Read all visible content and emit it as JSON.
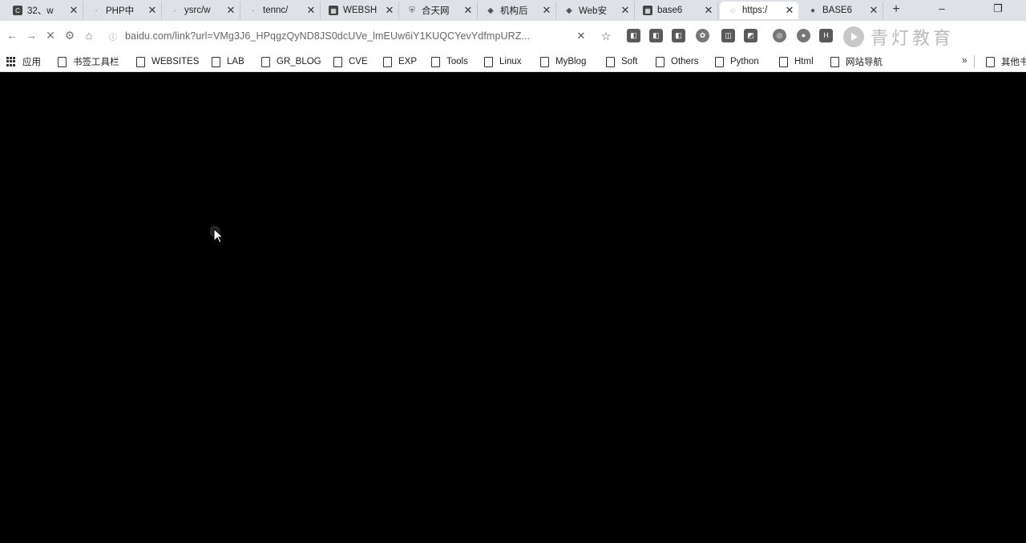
{
  "tabs": [
    {
      "title": "32、w",
      "favicon": "page-icon",
      "active": false
    },
    {
      "title": "PHP中",
      "favicon": "page-icon",
      "active": false
    },
    {
      "title": "ysrc/w",
      "favicon": "github-icon",
      "active": false
    },
    {
      "title": "tennc/",
      "favicon": "github-icon",
      "active": false
    },
    {
      "title": "WEBSH",
      "favicon": "page-icon",
      "active": false
    },
    {
      "title": "合天网",
      "favicon": "shield-icon",
      "active": false
    },
    {
      "title": "机构后",
      "favicon": "diamond-icon",
      "active": false
    },
    {
      "title": "Web安",
      "favicon": "diamond-icon",
      "active": false
    },
    {
      "title": "base6",
      "favicon": "page-icon",
      "active": false
    },
    {
      "title": "https:/",
      "favicon": "loading-icon",
      "active": true
    },
    {
      "title": "BASE6",
      "favicon": "dot-icon",
      "active": false
    }
  ],
  "address_bar": {
    "url": "baidu.com/link?url=VMg3J6_HPqgzQyND8JS0dcUVe_lmEUw6iY1KUQCYevYdfmpURZ..."
  },
  "watermark": {
    "text": "青灯教育"
  },
  "bookmarks": [
    {
      "label": "应用",
      "icon": "apps-grid-icon"
    },
    {
      "label": "书签工具栏",
      "icon": "folder-icon"
    },
    {
      "label": "WEBSITES",
      "icon": "folder-icon"
    },
    {
      "label": "LAB",
      "icon": "folder-icon"
    },
    {
      "label": "GR_BLOG",
      "icon": "folder-icon"
    },
    {
      "label": "CVE",
      "icon": "folder-icon"
    },
    {
      "label": "EXP",
      "icon": "folder-icon"
    },
    {
      "label": "Tools",
      "icon": "folder-icon"
    },
    {
      "label": "Linux",
      "icon": "folder-icon"
    },
    {
      "label": "MyBlog",
      "icon": "folder-icon"
    },
    {
      "label": "Soft",
      "icon": "folder-icon"
    },
    {
      "label": "Others",
      "icon": "folder-icon"
    },
    {
      "label": "Python",
      "icon": "folder-icon"
    },
    {
      "label": "Html",
      "icon": "folder-icon"
    },
    {
      "label": "网站导航",
      "icon": "folder-icon"
    }
  ],
  "bookmarks_more": "»",
  "other_bookmarks": "其他书签",
  "colors": {
    "tab_strip": "#dee1e6",
    "toolbar": "#ffffff",
    "content": "#000000"
  }
}
